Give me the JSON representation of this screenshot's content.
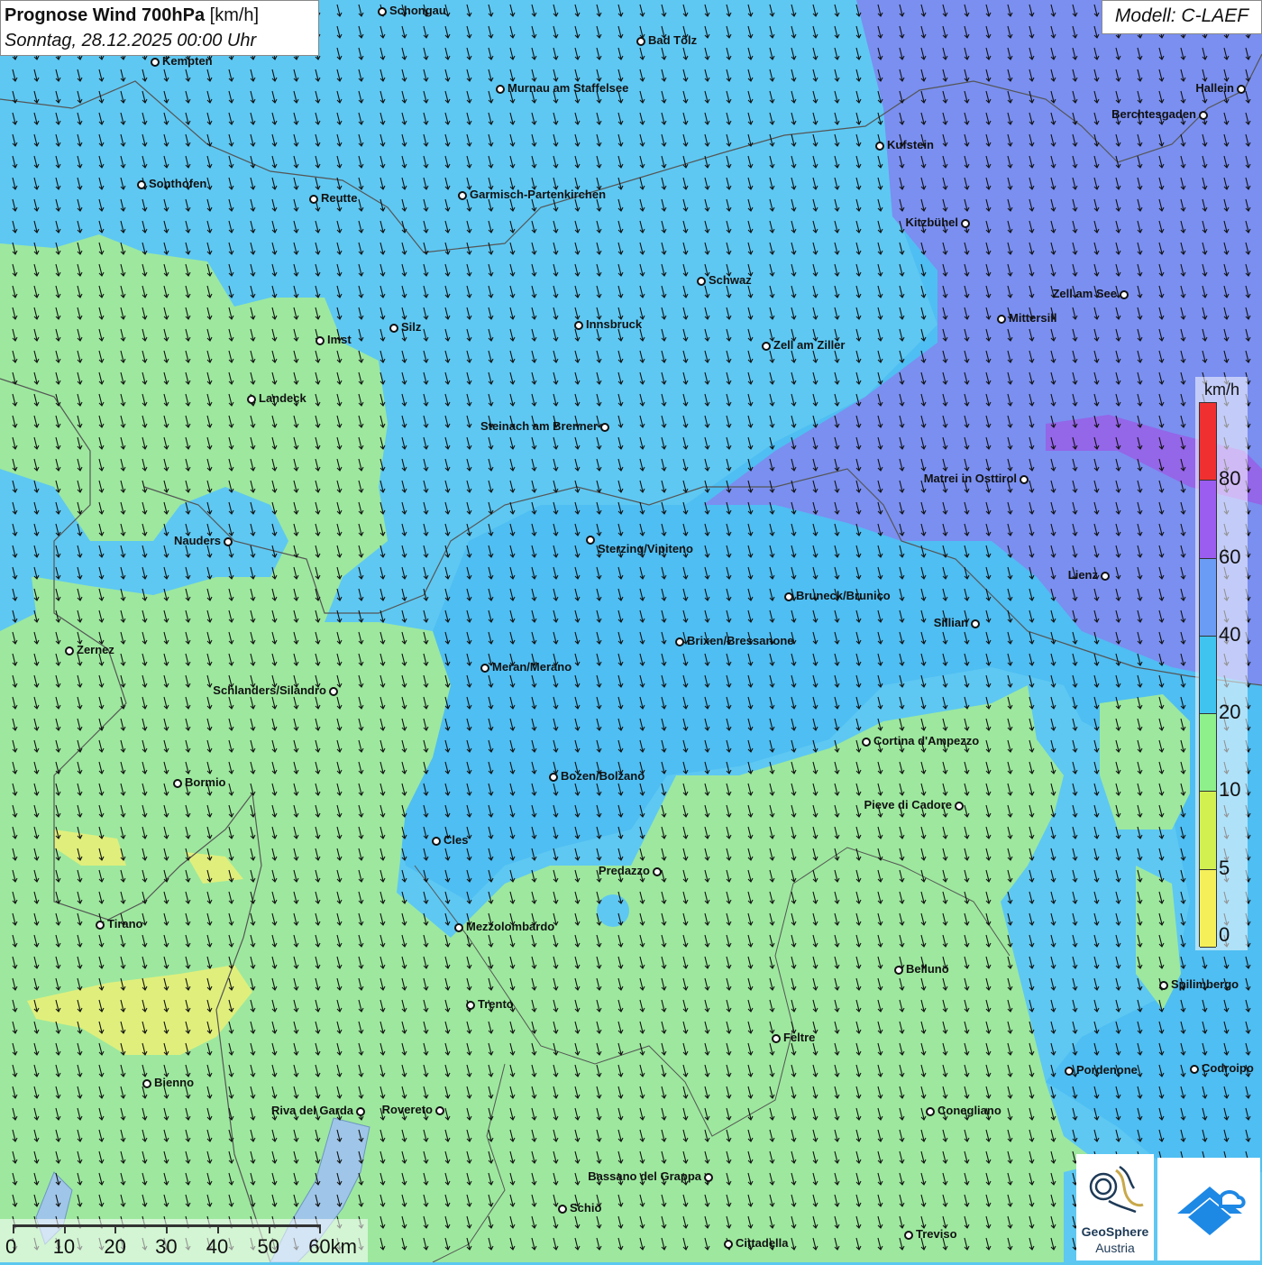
{
  "header": {
    "title_bold": "Prognose Wind 700hPa",
    "title_unit": "[km/h]",
    "datetime": "Sonntag, 28.12.2025 00:00 Uhr"
  },
  "model": "Modell: C-LAEF",
  "legend": {
    "unit": "km/h",
    "ticks": [
      "80",
      "60",
      "40",
      "20",
      "10",
      "5",
      "0"
    ],
    "colors": [
      "#f03030",
      "#9b5cf0",
      "#6b9cf5",
      "#3fc4f0",
      "#8ef08a",
      "#d2f050",
      "#f5f05a"
    ]
  },
  "scalebar": {
    "labels": [
      "0",
      "10",
      "20",
      "30",
      "40",
      "50",
      "60km"
    ]
  },
  "colors": {
    "strong_purple": "#9466e8",
    "purple_blue": "#7a8ff0",
    "blue": "#4fbef2",
    "cyan_blue": "#5ec8f2",
    "green": "#9de89e",
    "yellow": "#e0ef7c"
  },
  "cities": [
    {
      "name": "Schongau"
    },
    {
      "name": "Bad Tölz"
    },
    {
      "name": "Kempten"
    },
    {
      "name": "Murnau am Staffelsee"
    },
    {
      "name": "Hallein"
    },
    {
      "name": "Berchtesgaden"
    },
    {
      "name": "Kufstein"
    },
    {
      "name": "Sonthofen"
    },
    {
      "name": "Reutte"
    },
    {
      "name": "Garmisch-Partenkirchen"
    },
    {
      "name": "Kitzbühel"
    },
    {
      "name": "Schwaz"
    },
    {
      "name": "Zell am See"
    },
    {
      "name": "Mittersill"
    },
    {
      "name": "Silz"
    },
    {
      "name": "Innsbruck"
    },
    {
      "name": "Imst"
    },
    {
      "name": "Zell am Ziller"
    },
    {
      "name": "Landeck"
    },
    {
      "name": "Steinach am Brenner"
    },
    {
      "name": "Matrei in Osttirol"
    },
    {
      "name": "Nauders"
    },
    {
      "name": "Sterzing/Vipiteno"
    },
    {
      "name": "Lienz"
    },
    {
      "name": "Bruneck/Brunico"
    },
    {
      "name": "Sillian"
    },
    {
      "name": "Brixen/Bressanone"
    },
    {
      "name": "Zernez"
    },
    {
      "name": "Meran/Merano"
    },
    {
      "name": "Schlanders/Silandro"
    },
    {
      "name": "Cortina d'Ampezzo"
    },
    {
      "name": "Bozen/Bolzano"
    },
    {
      "name": "Bormio"
    },
    {
      "name": "Pieve di Cadore"
    },
    {
      "name": "Cles"
    },
    {
      "name": "Predazzo"
    },
    {
      "name": "Tirano"
    },
    {
      "name": "Mezzolombardo"
    },
    {
      "name": "Belluno"
    },
    {
      "name": "Spilimbergo"
    },
    {
      "name": "Trento"
    },
    {
      "name": "Feltre"
    },
    {
      "name": "Pordenone"
    },
    {
      "name": "Codroipo"
    },
    {
      "name": "Bienno"
    },
    {
      "name": "Riva del Garda"
    },
    {
      "name": "Rovereto"
    },
    {
      "name": "Conegliano"
    },
    {
      "name": "Bassano del Grappa"
    },
    {
      "name": "Schio"
    },
    {
      "name": "Treviso"
    },
    {
      "name": "Cittadella"
    }
  ],
  "logos": {
    "geosphere_line1": "GeoSphere",
    "geosphere_line2": "Austria"
  }
}
